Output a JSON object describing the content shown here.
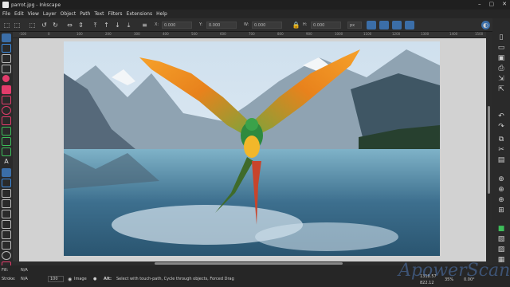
{
  "window": {
    "title": "parrot.jpg - Inkscape"
  },
  "menu": [
    "File",
    "Edit",
    "View",
    "Layer",
    "Object",
    "Path",
    "Text",
    "Filters",
    "Extensions",
    "Help"
  ],
  "commandbar": {
    "x_label": "X:",
    "x_value": "0.000",
    "y_label": "Y:",
    "y_value": "0.000",
    "w_label": "W:",
    "w_value": "0.000",
    "h_label": "H:",
    "h_value": "0.000",
    "unit": "px"
  },
  "ruler_ticks": [
    "-100",
    "0",
    "100",
    "200",
    "300",
    "400",
    "500",
    "600",
    "700",
    "800",
    "900",
    "1000",
    "1100",
    "1200",
    "1300",
    "1400",
    "1500"
  ],
  "status": {
    "fill_label": "Fill:",
    "fill_value": "N/A",
    "stroke_label": "Stroke:",
    "stroke_value": "N/A",
    "opacity": "100",
    "layer": "Image",
    "message_key": "Alt:",
    "message": "Select with touch-path, Cycle through objects, Forced Drag",
    "coord_x": "1318.57",
    "coord_y": "822.12",
    "zoom": "35%",
    "rotation": "0.00°"
  },
  "watermark": "ApowerScan",
  "colors": {
    "accent": "#3b6ea8",
    "canvas": "#d2d2d2",
    "chrome": "#2b2b2b"
  }
}
